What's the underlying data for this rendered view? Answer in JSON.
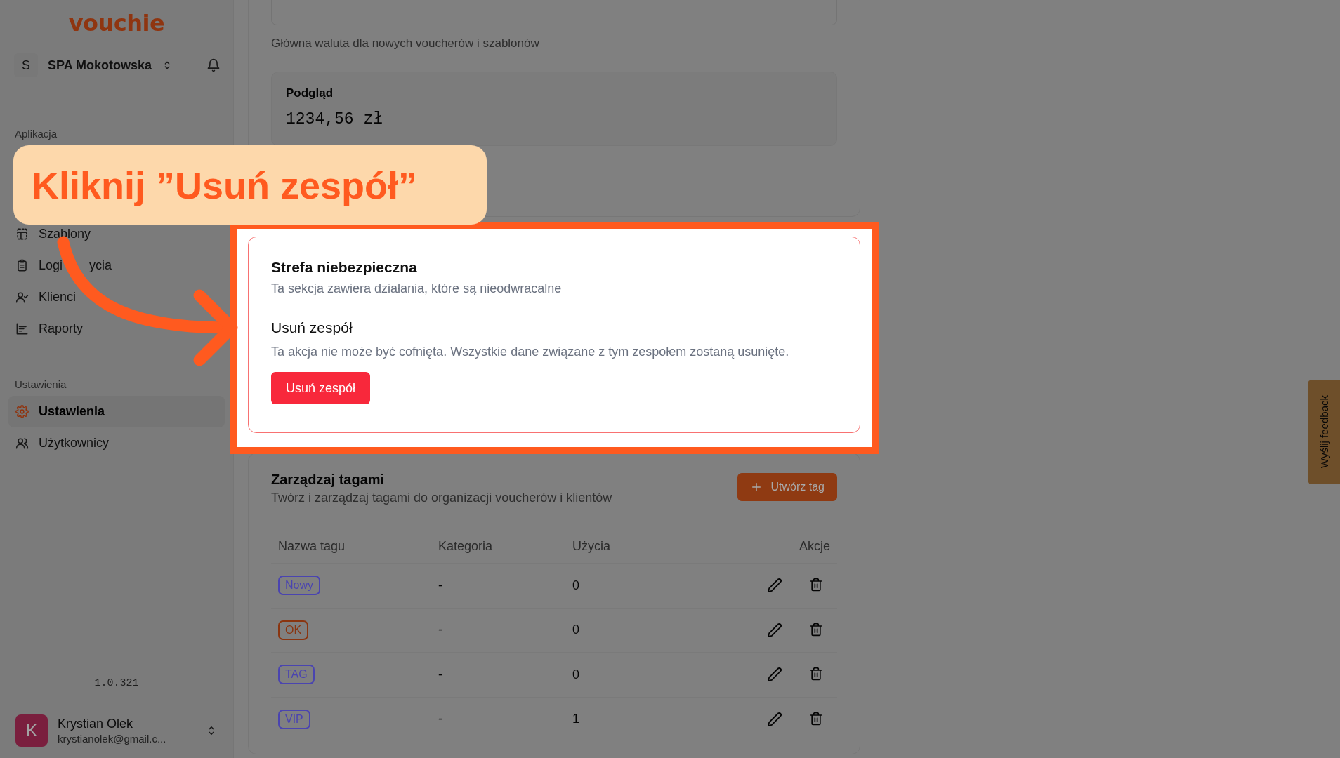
{
  "sidebar": {
    "logo": "vouchie",
    "team": {
      "initial": "S",
      "name": "SPA Mokotowska"
    },
    "sections": [
      {
        "title": "Aplikacja",
        "items": [
          {
            "label": "Szablony",
            "selected": false
          },
          {
            "label": "Logi",
            "label_after_arrow": "ycia",
            "selected": false
          },
          {
            "label": "Klienci",
            "selected": false
          },
          {
            "label": "Raporty",
            "selected": false
          }
        ]
      },
      {
        "title": "Ustawienia",
        "items": [
          {
            "label": "Ustawienia",
            "selected": true
          },
          {
            "label": "Użytkownicy",
            "selected": false
          }
        ]
      }
    ],
    "version": "1.0.321",
    "user": {
      "initial": "K",
      "name": "Krystian Olek",
      "email": "krystianolek@gmail.c..."
    }
  },
  "currency": {
    "hint": "Główna waluta dla nowych voucherów i szablonów",
    "preview_label": "Podgląd",
    "preview_value": "1234,56 zł"
  },
  "danger_zone": {
    "title": "Strefa niebezpieczna",
    "subtitle": "Ta sekcja zawiera działania, które są nieodwracalne",
    "action_title": "Usuń zespół",
    "action_description": "Ta akcja nie może być cofnięta. Wszystkie dane związane z tym zespołem zostaną usunięte.",
    "button": "Usuń zespół"
  },
  "tags": {
    "title": "Zarządzaj tagami",
    "subtitle": "Twórz i zarządzaj tagami do organizacji voucherów i klientów",
    "create_button": "Utwórz tag",
    "columns": [
      "Nazwa tagu",
      "Kategoria",
      "Użycia",
      "Akcje"
    ],
    "rows": [
      {
        "tag": "Nowy",
        "color": "#4a44b0",
        "category": "-",
        "uses": "0"
      },
      {
        "tag": "OK",
        "color": "#8a3510",
        "category": "-",
        "uses": "0"
      },
      {
        "tag": "TAG",
        "color": "#4a44b0",
        "category": "-",
        "uses": "0"
      },
      {
        "tag": "VIP",
        "color": "#4a44b0",
        "category": "-",
        "uses": "1"
      }
    ]
  },
  "feedback_tab": "Wyślij feedback",
  "tutorial": {
    "callout": "Kliknij ”Usuń zespół”"
  }
}
